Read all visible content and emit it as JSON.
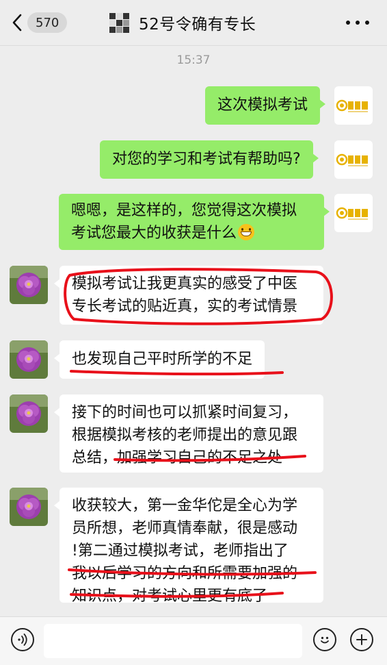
{
  "header": {
    "unread_count": "570",
    "title": "52号令确有专长"
  },
  "timestamp": "15:37",
  "messages": [
    {
      "sender": "me",
      "text": "这次模拟考试"
    },
    {
      "sender": "me",
      "text": "对您的学习和考试有帮助吗?"
    },
    {
      "sender": "me",
      "text_line1": "嗯嗯，是这样的，您觉得这次模拟",
      "text_line2": "考试您最大的收获是什么"
    },
    {
      "sender": "them",
      "text_line1": "模拟考试让我更真实的感受了中医",
      "text_line2": "专长考试的贴近真，实的考试情景"
    },
    {
      "sender": "them",
      "text": "也发现自己平时所学的不足"
    },
    {
      "sender": "them",
      "text_line1": "接下的时间也可以抓紧时间复习，",
      "text_line2": "根据模拟考核的老师提出的意见跟",
      "text_line3a": "总结，",
      "text_line3b": "加强学习自己的不足之处"
    },
    {
      "sender": "them",
      "text_line1": "收获较大，第一金华佗是全心为学",
      "text_line2": "员所想，老师真情奉献，很是感动",
      "text_line3": "!第二通过模拟考试，老师指出了",
      "text_line4": "我以后学习的方向和所需要加强的",
      "text_line5": "知识点，对考试心里更有底了"
    }
  ],
  "colors": {
    "background": "#ededed",
    "sent_bubble": "#95ec69",
    "received_bubble": "#ffffff",
    "annotation_red": "#e8101a"
  },
  "icons": {
    "back": "chevron-left-icon",
    "more": "more-dots-icon",
    "voice": "voice-icon",
    "emoji": "emoji-icon",
    "add": "plus-icon"
  }
}
